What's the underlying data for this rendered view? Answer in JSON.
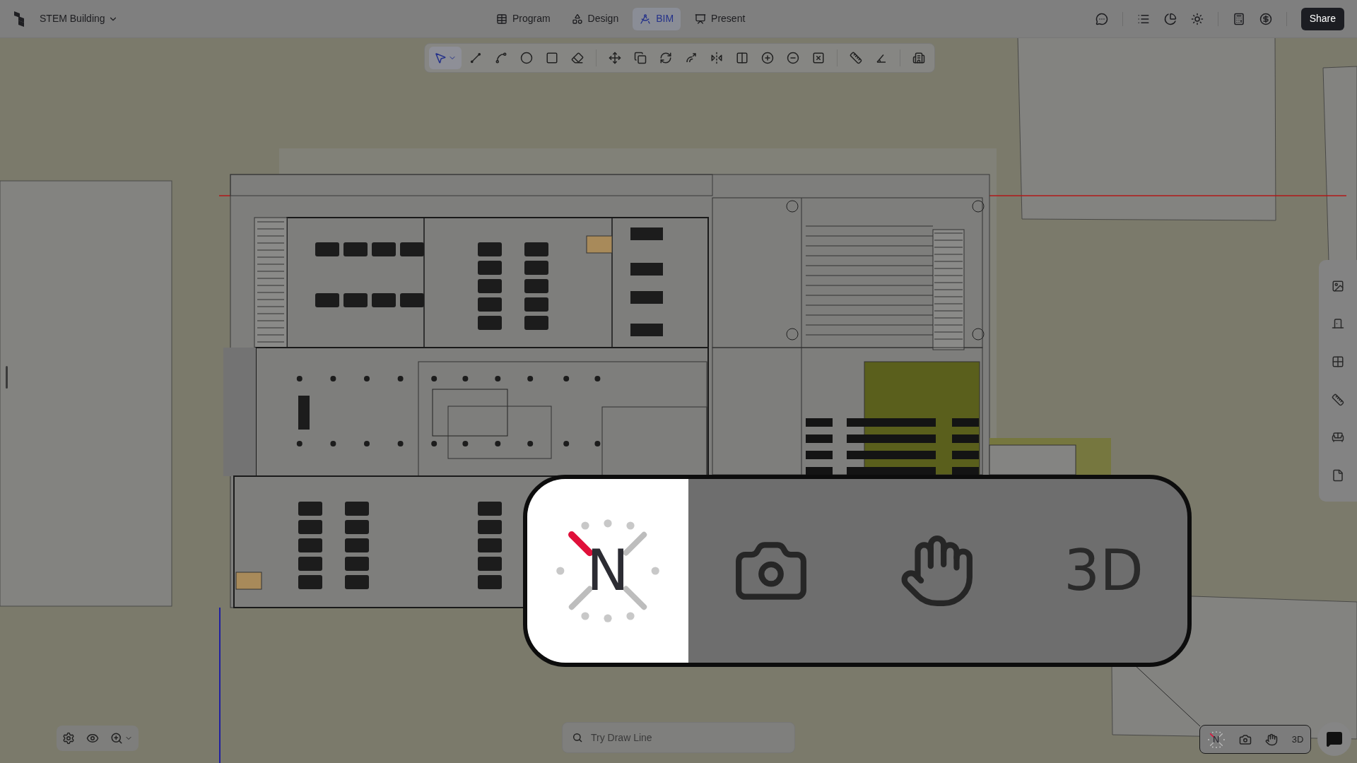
{
  "project": {
    "name": "STEM Building"
  },
  "tabs": [
    {
      "label": "Program",
      "selected": false
    },
    {
      "label": "Design",
      "selected": false
    },
    {
      "label": "BIM",
      "selected": true
    },
    {
      "label": "Present",
      "selected": false
    }
  ],
  "share_button": "Share",
  "toolbar": {
    "tools": [
      {
        "selected": true
      },
      {
        "selected": false
      },
      {
        "selected": false
      },
      {
        "selected": false
      },
      {
        "selected": false
      },
      {
        "selected": false
      },
      {
        "selected": false
      },
      {
        "selected": false
      },
      {
        "selected": false
      },
      {
        "selected": false
      },
      {
        "selected": false
      },
      {
        "selected": false
      },
      {
        "selected": false
      },
      {
        "selected": false
      },
      {
        "selected": false
      },
      {
        "selected": false
      },
      {
        "selected": false
      },
      {
        "selected": false
      }
    ]
  },
  "search": {
    "placeholder": "Try Draw Line"
  },
  "view_controls": {
    "compass_label": "N",
    "mode_label": "3D"
  },
  "callout": {
    "compass_label": "N",
    "mode_label": "3D"
  }
}
